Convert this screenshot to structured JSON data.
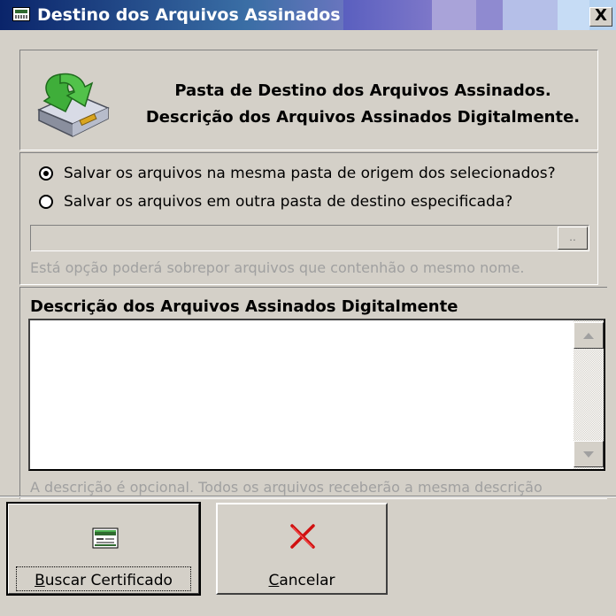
{
  "window": {
    "title": "Destino dos Arquivos Assinados",
    "close_label": "X"
  },
  "header": {
    "line1": "Pasta de Destino dos Arquivos Assinados.",
    "line2": "Descrição dos Arquivos Assinados Digitalmente."
  },
  "destination": {
    "options": [
      {
        "label": "Salvar os arquivos na mesma pasta de origem dos selecionados?",
        "checked": true
      },
      {
        "label": "Salvar os arquivos em outra pasta de destino especificada?",
        "checked": false
      }
    ],
    "path_value": "",
    "browse_label": "..",
    "hint": "Está opção poderá sobrepor arquivos que contenhão o mesmo nome."
  },
  "description": {
    "title": "Descrição dos Arquivos Assinados Digitalmente",
    "value": "",
    "hint": "A descrição é opcional. Todos os arquivos receberão a mesma descrição"
  },
  "buttons": {
    "search_cert_label": "Buscar Certificado",
    "cancel_label": "Cancelar"
  },
  "icons": {
    "header": "disk-download-icon",
    "title": "certificate-icon",
    "search_cert": "certificate-icon",
    "cancel": "red-x-icon"
  }
}
